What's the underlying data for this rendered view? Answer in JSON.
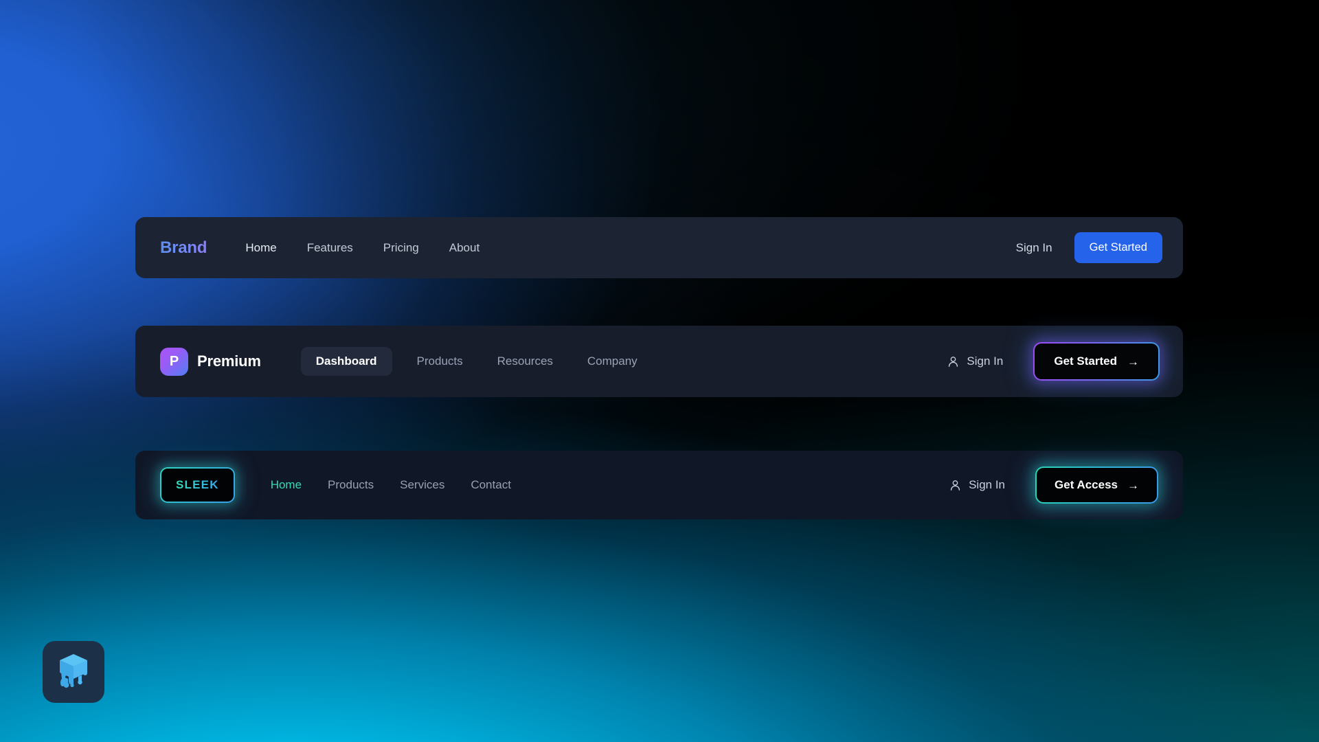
{
  "page": {
    "title": "Navigation Bar Component Showcase",
    "background": {
      "colors": [
        "#2563d8",
        "#00c8ef",
        "#0a8c96",
        "#000000"
      ],
      "style": "mesh-gradient"
    }
  },
  "navbars": [
    {
      "id": "navbar-basic",
      "brand": "Brand",
      "brand_gradient": [
        "#5b8def",
        "#8b7ef8"
      ],
      "background": "#1c2333",
      "links": [
        "Home",
        "Features",
        "Pricing",
        "About"
      ],
      "signin_label": "Sign In",
      "cta_label": "Get Started",
      "cta_color": "#2563eb"
    },
    {
      "id": "navbar-premium",
      "logo_initial": "P",
      "logo_text": "Premium",
      "logo_gradient": [
        "#a855f7",
        "#4f7ef4"
      ],
      "background": "#171d2b",
      "links": [
        "Dashboard",
        "Products",
        "Resources",
        "Company"
      ],
      "active_link": "Dashboard",
      "signin_label": "Sign In",
      "signin_icon": "user-icon",
      "cta_label": "Get Started",
      "cta_arrow": "→",
      "cta_glow": [
        "#9d4bf5",
        "#3b9ae8"
      ]
    },
    {
      "id": "navbar-sleek",
      "logo_text": "SLEEK",
      "logo_gradient": [
        "#35e0b6",
        "#3ba4ef"
      ],
      "background": "#101726",
      "links": [
        "Home",
        "Products",
        "Services",
        "Contact"
      ],
      "active_link": "Home",
      "active_color": "#2edfb4",
      "signin_label": "Sign In",
      "signin_icon": "user-icon",
      "cta_label": "Get Access",
      "cta_arrow": "→",
      "cta_glow": [
        "#2ad4b6",
        "#3c98ea"
      ]
    }
  ],
  "app_icon": {
    "name": "melting-ice-cube-icon",
    "color": "#4db8f0",
    "background": "#1c3148"
  }
}
